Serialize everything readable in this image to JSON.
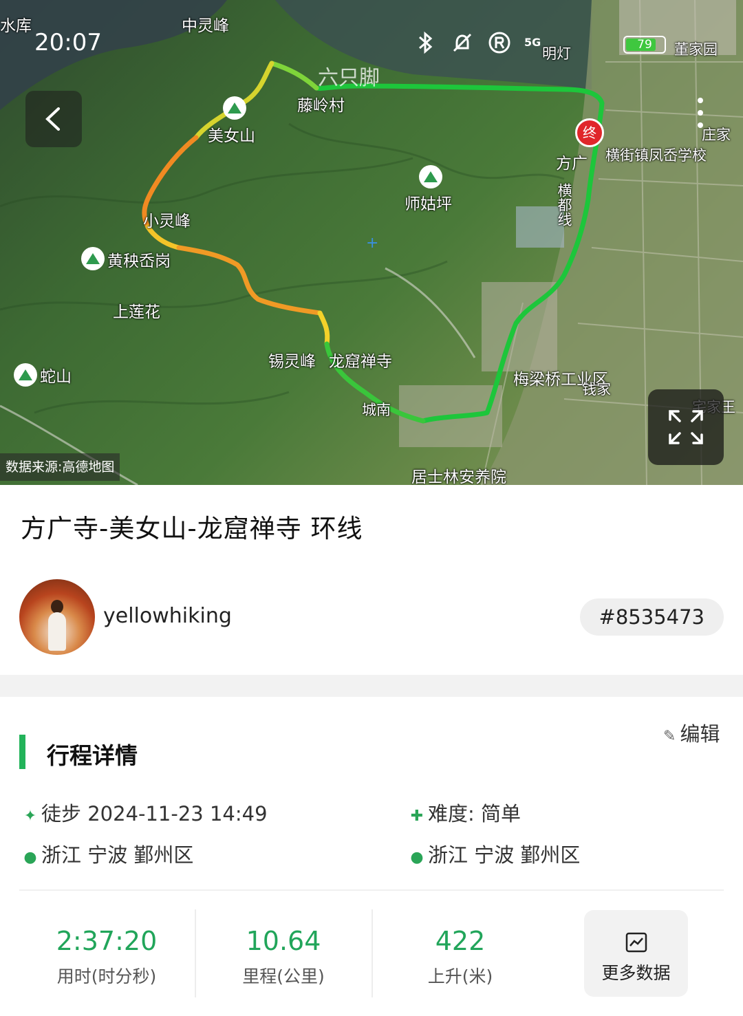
{
  "status_bar": {
    "time": "20:07",
    "icons": [
      "bluetooth-icon",
      "mute-icon",
      "registered-icon"
    ],
    "network": "5G",
    "battery": "79",
    "battery_level": 0.79
  },
  "map": {
    "source": "数据来源:高德地图",
    "watermark": "六只脚",
    "end_marker": "终",
    "labels": {
      "reservoir": "水库",
      "zhonglingfeng": "中灵峰",
      "tenglingcun": "藤岭村",
      "meinvshan": "美女山",
      "shigu": "师姑坪",
      "xiaolingfeng": "小灵峰",
      "huangqiuling": "黄秧岙岗",
      "shanglianhua": "上莲花",
      "sheshan": "蛇山",
      "xilingfeng": "锡灵峰",
      "longku": "龙窟禅寺",
      "fangguang": "方广",
      "school": "横街镇凤岙学校",
      "hengjiexian": "横都线",
      "meiliangqiao": "梅梁桥工业区",
      "qianjia": "钱家",
      "jushilin": "居士林安养院",
      "chengnan": "城南",
      "dongjiayuan": "董家园",
      "zhuangjia": "庄家",
      "mingguang": "明灯",
      "zhaijia": "宅家王"
    },
    "track_colors": {
      "start": "#19c038",
      "mid": "#f3d22a",
      "peak": "#f07b22"
    }
  },
  "route": {
    "title": "方广寺-美女山-龙窟禅寺 环线"
  },
  "author": {
    "username": "yellowhiking",
    "track_id": "#8535473"
  },
  "details": {
    "section_title": "行程详情",
    "edit_label": "编辑",
    "activity": "徒步 2024-11-23 14:49",
    "difficulty": "难度: 简单",
    "start_location": "浙江 宁波 鄞州区",
    "end_location": "浙江 宁波 鄞州区"
  },
  "stats": {
    "duration": {
      "value": "2:37:20",
      "label": "用时(时分秒)"
    },
    "distance": {
      "value": "10.64",
      "label": "里程(公里)"
    },
    "ascent": {
      "value": "422",
      "label": "上升(米)"
    },
    "more": "更多数据"
  },
  "colors": {
    "accent": "#22b35a",
    "end_marker": "#e0262a"
  }
}
